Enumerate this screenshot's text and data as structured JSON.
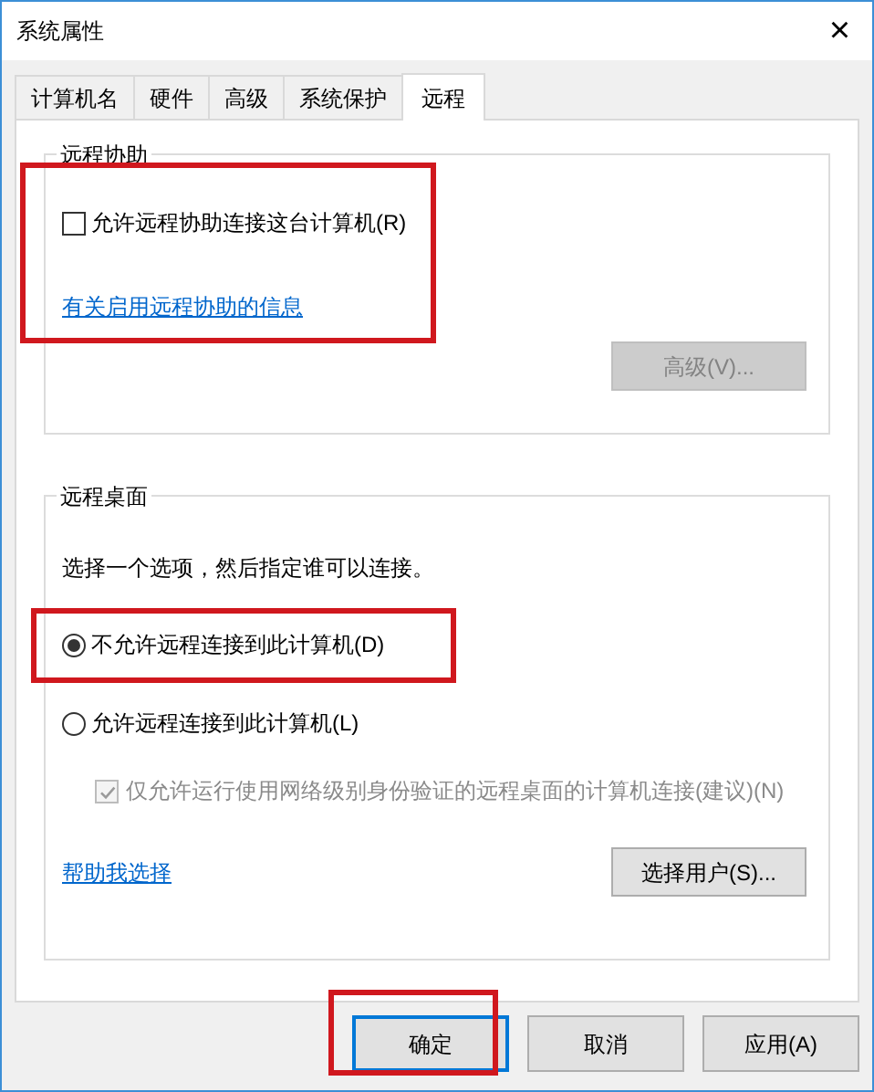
{
  "window": {
    "title": "系统属性",
    "close": "×"
  },
  "tabs": [
    {
      "label": "计算机名",
      "selected": false
    },
    {
      "label": "硬件",
      "selected": false
    },
    {
      "label": "高级",
      "selected": false
    },
    {
      "label": "系统保护",
      "selected": false
    },
    {
      "label": "远程",
      "selected": true
    }
  ],
  "remote_assistance": {
    "title": "远程协助",
    "highlighted": true,
    "checkbox": {
      "label": "允许远程协助连接这台计算机(R)",
      "checked": false
    },
    "link": "有关启用远程协助的信息",
    "button": {
      "label": "高级(V)...",
      "disabled": true
    }
  },
  "remote_desktop": {
    "title": "远程桌面",
    "prompt": "选择一个选项，然后指定谁可以连接。",
    "options": [
      {
        "label": "不允许远程连接到此计算机(D)",
        "selected": true,
        "highlighted": true
      },
      {
        "label": "允许远程连接到此计算机(L)",
        "selected": false,
        "highlighted": false
      }
    ],
    "nla": {
      "label": "仅允许运行使用网络级别身份验证的远程桌面的计算机连接(建议)(N)",
      "checked": true,
      "disabled": true
    },
    "link": "帮助我选择",
    "button": {
      "label": "选择用户(S)..."
    }
  },
  "buttons": [
    {
      "label": "确定",
      "default": true,
      "highlighted": true
    },
    {
      "label": "取消",
      "default": false,
      "highlighted": false
    },
    {
      "label": "应用(A)",
      "default": false,
      "highlighted": false
    }
  ]
}
